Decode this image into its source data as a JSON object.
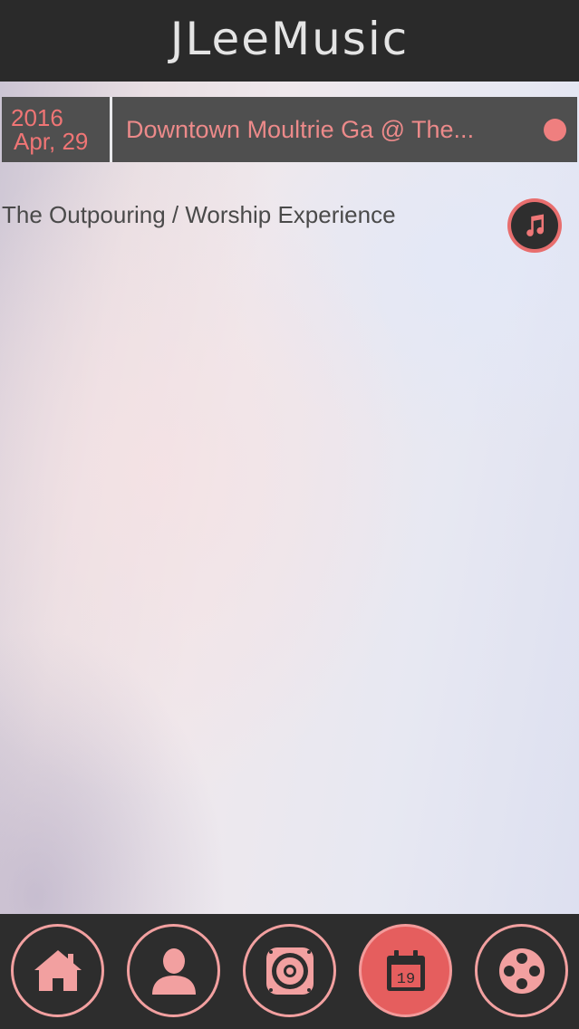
{
  "header": {
    "title": "JLeeMusic"
  },
  "event": {
    "year": "2016",
    "date": "Apr, 29",
    "title": "Downtown Moultrie Ga @ The..."
  },
  "description": "The Outpouring / Worship Experience",
  "music_button": {
    "icon": "music-note-icon"
  },
  "tabs": [
    {
      "name": "home",
      "icon": "home-icon",
      "active": false
    },
    {
      "name": "profile",
      "icon": "person-icon",
      "active": false
    },
    {
      "name": "audio",
      "icon": "speaker-icon",
      "active": false
    },
    {
      "name": "events",
      "icon": "calendar-icon",
      "active": true,
      "calendar_day": "19"
    },
    {
      "name": "video",
      "icon": "film-reel-icon",
      "active": false
    }
  ],
  "colors": {
    "accent": "#f07575",
    "header_bg": "#2a2a2a",
    "tab_active": "#e55e5e"
  }
}
